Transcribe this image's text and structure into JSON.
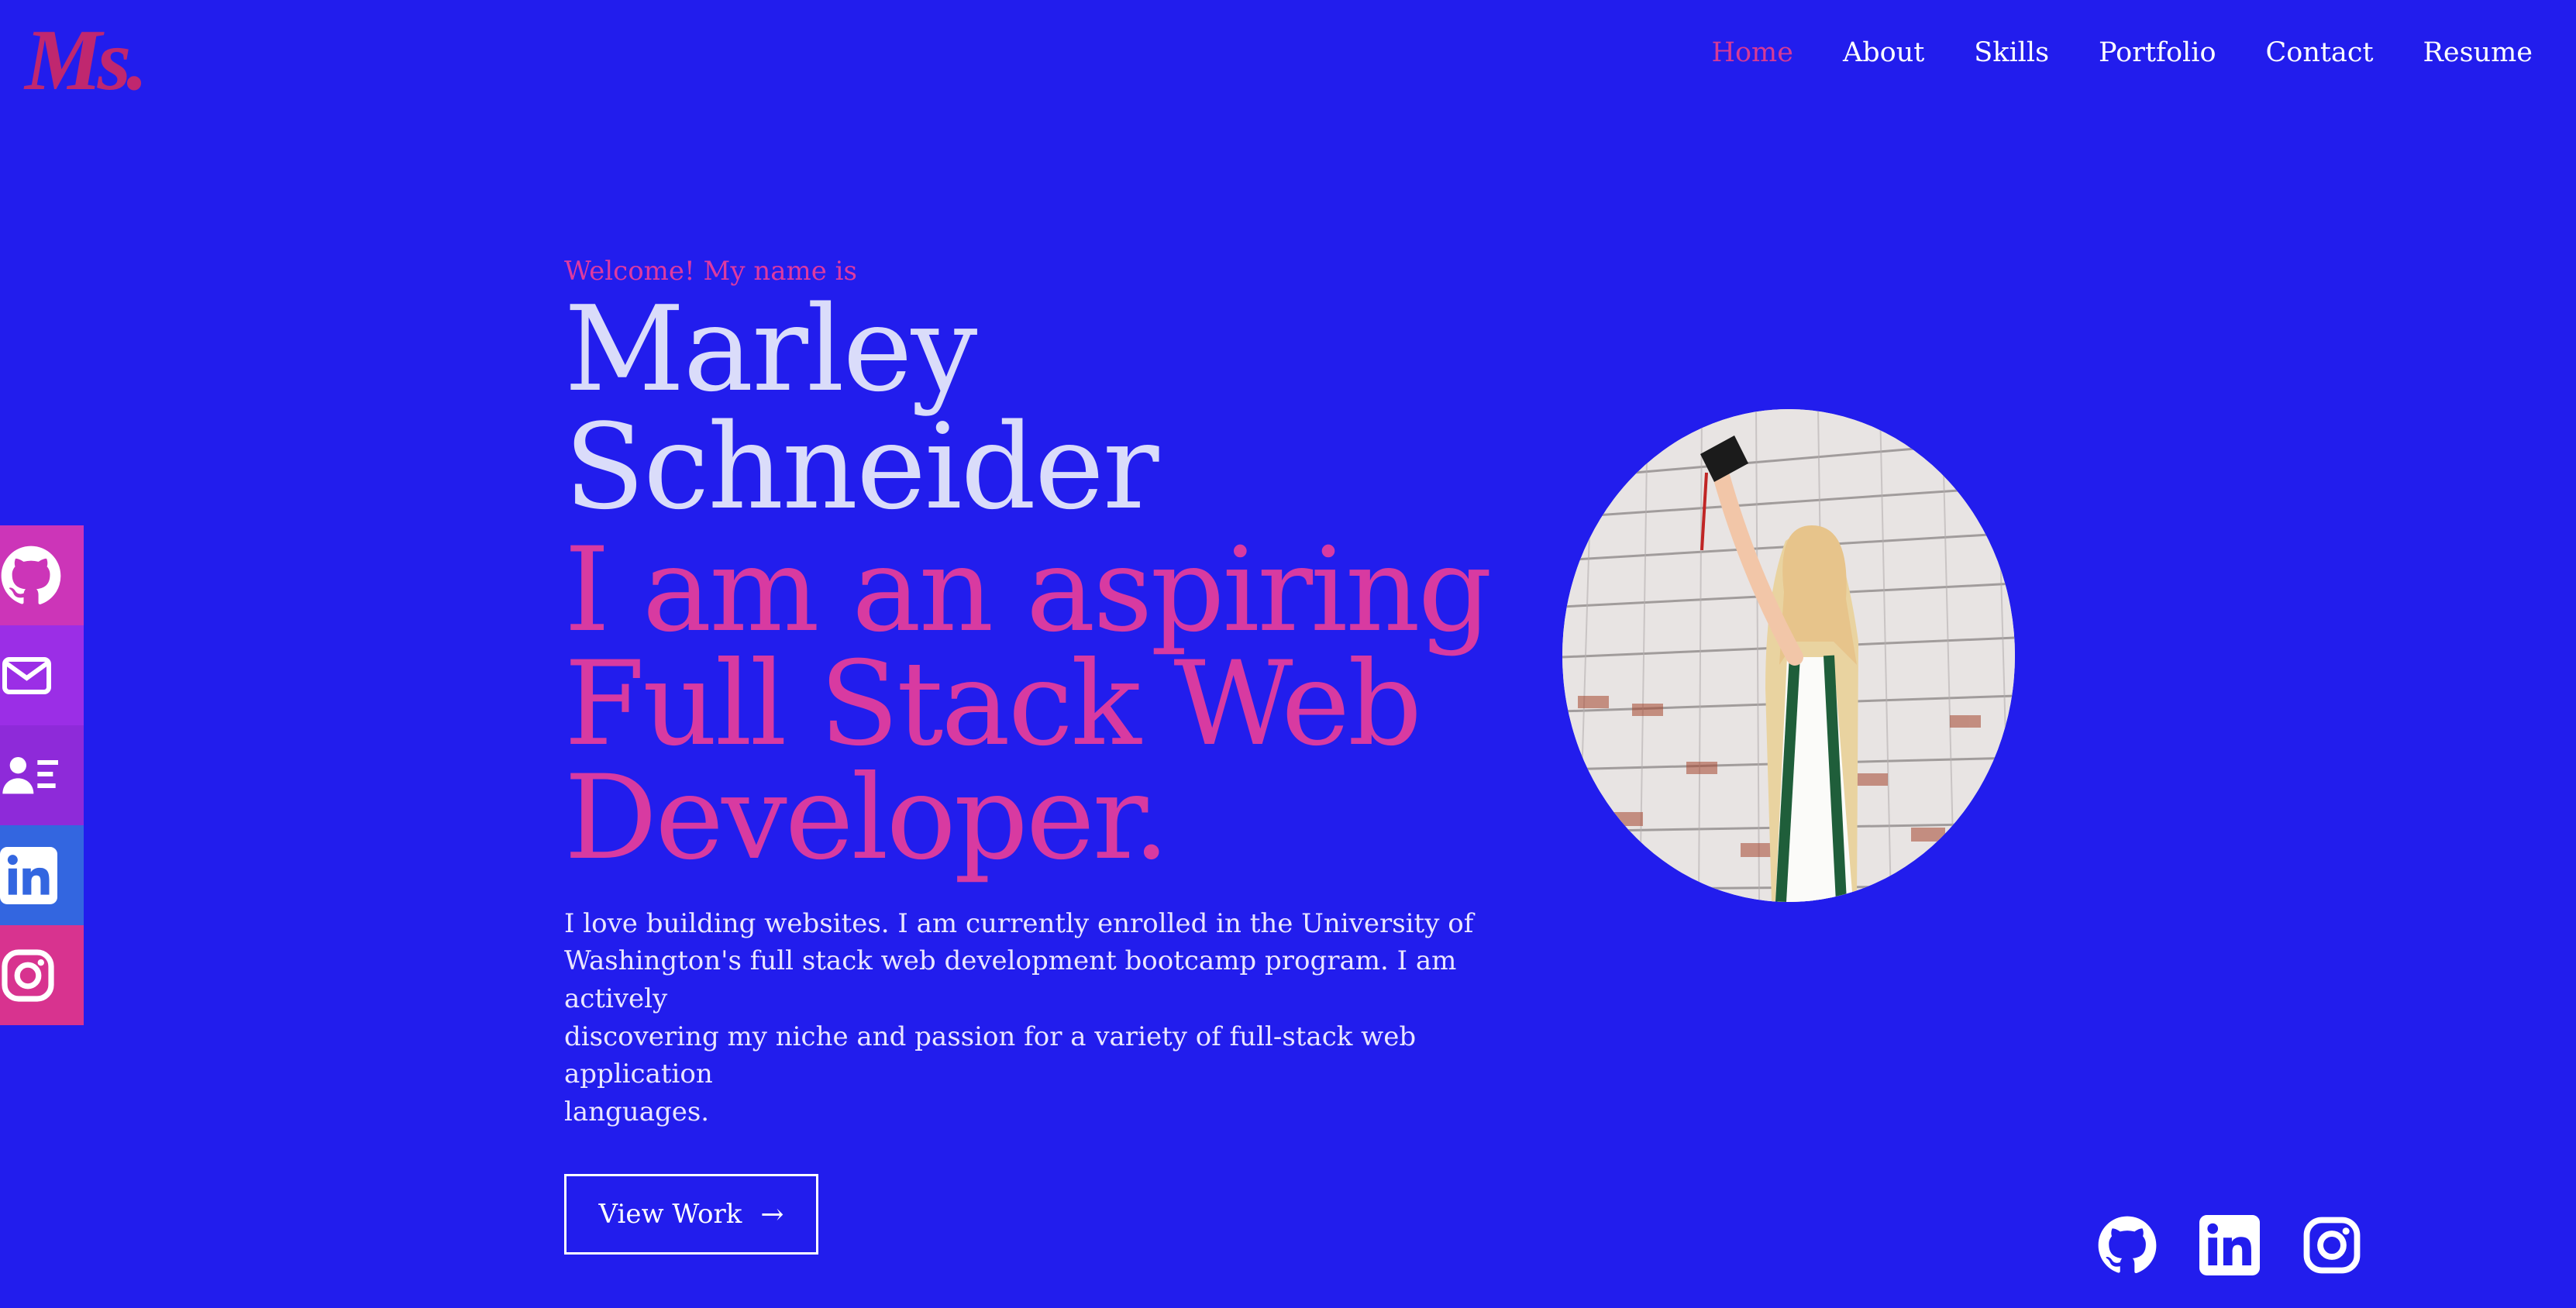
{
  "brand": {
    "logo_text": "Ms.",
    "accent": "#d63a95",
    "background": "#221ded"
  },
  "nav": {
    "items": [
      {
        "label": "Home",
        "active": true
      },
      {
        "label": "About",
        "active": false
      },
      {
        "label": "Skills",
        "active": false
      },
      {
        "label": "Portfolio",
        "active": false
      },
      {
        "label": "Contact",
        "active": false
      },
      {
        "label": "Resume",
        "active": false
      }
    ]
  },
  "hero": {
    "welcome": "Welcome! My name is",
    "name": "Marley Schneider",
    "tagline_lines": [
      "I am an aspiring",
      "Full Stack Web",
      "Developer."
    ],
    "intro_lines": [
      "I love building websites. I am currently enrolled in the University of",
      "Washington's full stack web development bootcamp program. I am actively",
      "discovering my niche and passion for a variety of full-stack web application",
      "languages."
    ],
    "cta_label": "View Work",
    "cta_arrow": "→"
  },
  "sidebar": {
    "items": [
      {
        "name": "github",
        "icon": "github-icon",
        "color": "#cc35b8"
      },
      {
        "name": "email",
        "icon": "mail-icon",
        "color": "#9b2ee6"
      },
      {
        "name": "resume",
        "icon": "contact-card-icon",
        "color": "#8e2ad9"
      },
      {
        "name": "linkedin",
        "icon": "linkedin-icon",
        "color": "#3366e0"
      },
      {
        "name": "instagram",
        "icon": "instagram-icon",
        "color": "#d8338f"
      }
    ]
  },
  "footer_icons": [
    "github-icon",
    "linkedin-icon",
    "instagram-icon"
  ]
}
